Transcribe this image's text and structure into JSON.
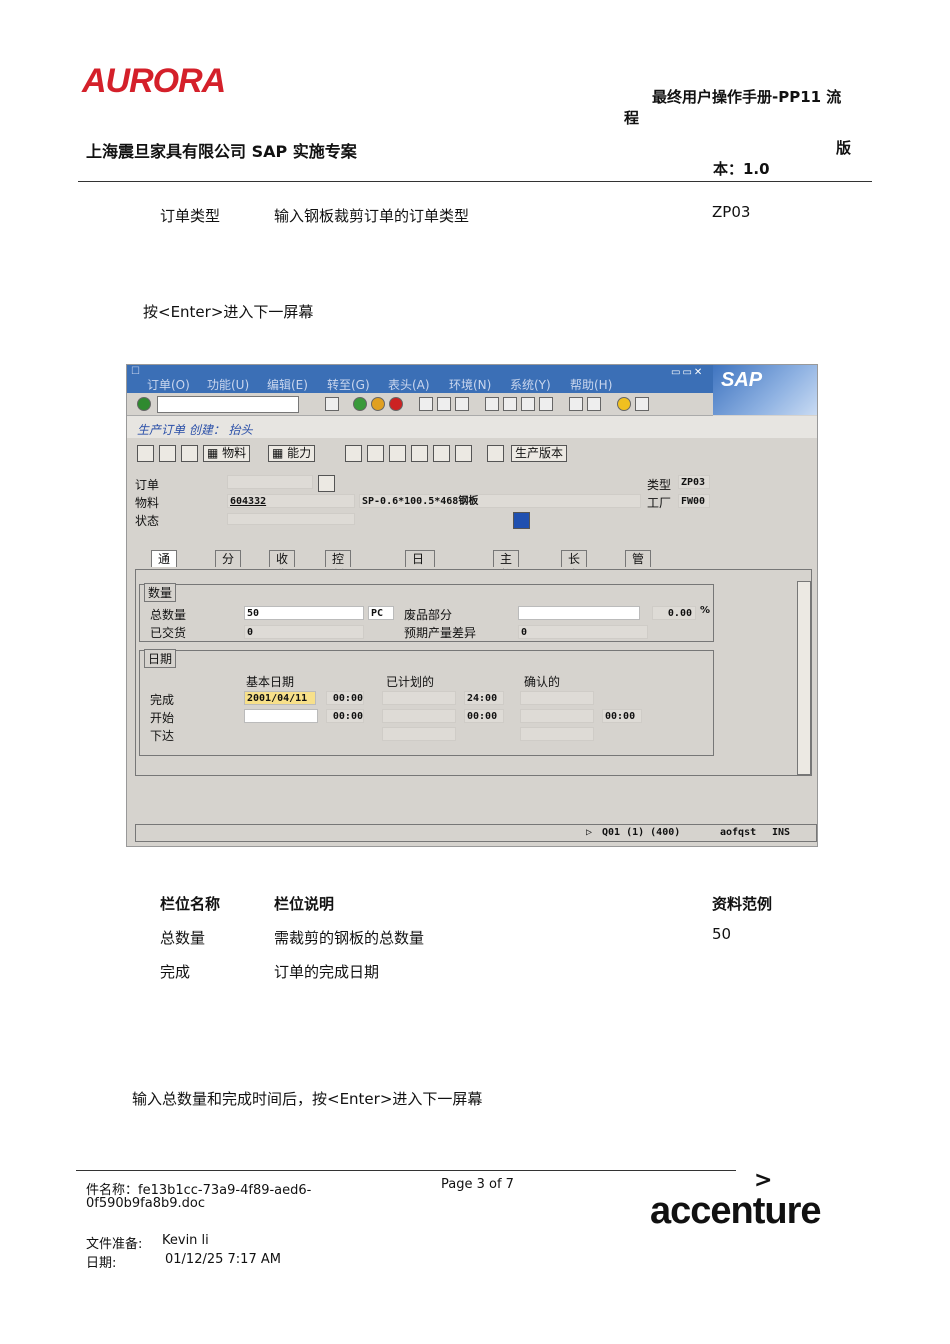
{
  "header": {
    "logo_text": "AURORA",
    "manual_title_line1": "最终用户操作手册-PP11 流",
    "manual_title_line2": "程",
    "company": "上海震旦家具有限公司 SAP 实施专案",
    "version_line1": "版",
    "version_line2": "本：1.0"
  },
  "top_row": {
    "name": "订单类型",
    "desc": "输入钢板裁剪订单的订单类型",
    "example": "ZP03"
  },
  "instruction1": "按<Enter>进入下一屏幕",
  "sap": {
    "menu": [
      "订单(O)",
      "功能(U)",
      "编辑(E)",
      "转至(G)",
      "表头(A)",
      "环境(N)",
      "系统(Y)",
      "帮助(H)"
    ],
    "sap_logo": "SAP",
    "title": "生产订单 创建： 抬头",
    "app_buttons": {
      "material": "物料",
      "capacity": "能力",
      "prod_version": "生产版本"
    },
    "header_fields": {
      "order_label": "订单",
      "material_label": "物料",
      "material_value": "604332",
      "material_desc": "SP-0.6*100.5*468钢板",
      "status_label": "状态",
      "type_label": "类型",
      "type_value": "ZP03",
      "plant_label": "工厂",
      "plant_value": "FW00"
    },
    "tabs": [
      "通用的",
      "分配",
      "收货",
      "控制数据",
      "日期/数量",
      "主数据",
      "长文本",
      "管理机构"
    ],
    "qty_group": {
      "title": "数量",
      "total_label": "总数量",
      "total_value": "50",
      "unit": "PC",
      "scrap_label": "废品部分",
      "scrap_value": "0.00",
      "pct": "%",
      "delivered_label": "已交货",
      "delivered_value": "0",
      "expected_var_label": "预期产量差异",
      "expected_var_value": "0"
    },
    "date_group": {
      "title": "日期",
      "col_basic": "基本日期",
      "col_planned": "已计划的",
      "col_confirmed": "确认的",
      "finish_label": "完成",
      "start_label": "开始",
      "release_label": "下达",
      "finish_date": "2001/04/11",
      "finish_time": "00:00",
      "finish_planned_time": "24:00",
      "start_time": "00:00",
      "start_planned_time": "00:00",
      "start_confirmed_time": "00:00"
    },
    "status_bar": {
      "system": "Q01 (1) (400)",
      "server": "aofqst",
      "mode": "INS"
    }
  },
  "table": {
    "headers": [
      "栏位名称",
      "栏位说明",
      "资料范例"
    ],
    "rows": [
      [
        "总数量",
        "需裁剪的钢板的总数量",
        "50"
      ],
      [
        "完成",
        "订单的完成日期",
        ""
      ]
    ]
  },
  "instruction2": "输入总数量和完成时间后，按<Enter>进入下一屏幕",
  "footer": {
    "filename_line1": "件名称：fe13b1cc-73a9-4f89-aed6-",
    "filename_line2": "0f590b9fa8b9.doc",
    "page": "Page 3 of 7",
    "preparer_label": "文件准备:",
    "preparer": "Kevin li",
    "date_label": "日期:",
    "date": "01/12/25 7:17 AM",
    "brand": "accenture",
    "brand_mark": ">"
  }
}
